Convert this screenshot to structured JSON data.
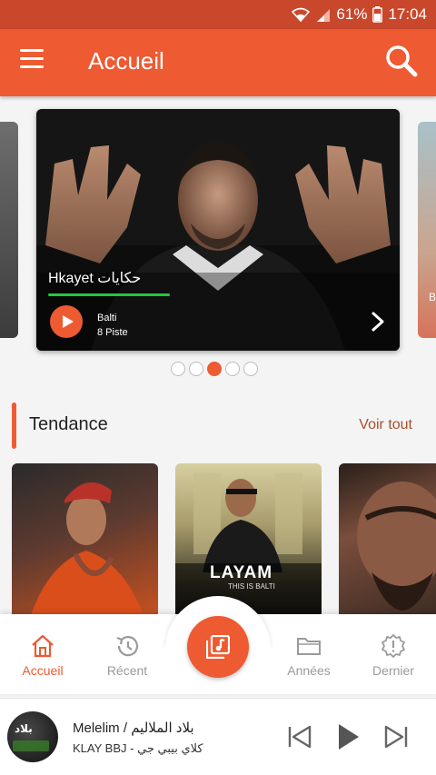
{
  "status_bar": {
    "battery": "61%",
    "time": "17:04"
  },
  "app_bar": {
    "title": "Accueil"
  },
  "carousel": {
    "featured": {
      "title": "Hkayet حكايات",
      "artist": "Balti",
      "tracks": "8 Piste"
    },
    "peek_text": "B",
    "dots_count": 5,
    "active_dot": 2
  },
  "section": {
    "title": "Tendance",
    "see_all": "Voir tout"
  },
  "trending": [
    {
      "name": "trending-1"
    },
    {
      "name": "trending-2",
      "cover_title": "LAYAM",
      "cover_subtitle": "THIS IS BALTI"
    },
    {
      "name": "trending-3"
    }
  ],
  "nav": {
    "items": [
      {
        "label": "Accueil",
        "icon": "home-icon",
        "active": true
      },
      {
        "label": "Récent",
        "icon": "history-icon",
        "active": false
      },
      {
        "label": "Années",
        "icon": "folder-icon",
        "active": false
      },
      {
        "label": "Dernier",
        "icon": "badge-icon",
        "active": false
      }
    ],
    "fab_icon": "music-library-icon"
  },
  "player": {
    "art_text": "بلاد",
    "title": "Melelim / بلاد الملاليم",
    "subtitle": "KLAY BBJ - كلاي بيبي جي"
  },
  "colors": {
    "accent": "#ee5a32",
    "status_bar": "#c9472b",
    "progress": "#22c93a"
  }
}
